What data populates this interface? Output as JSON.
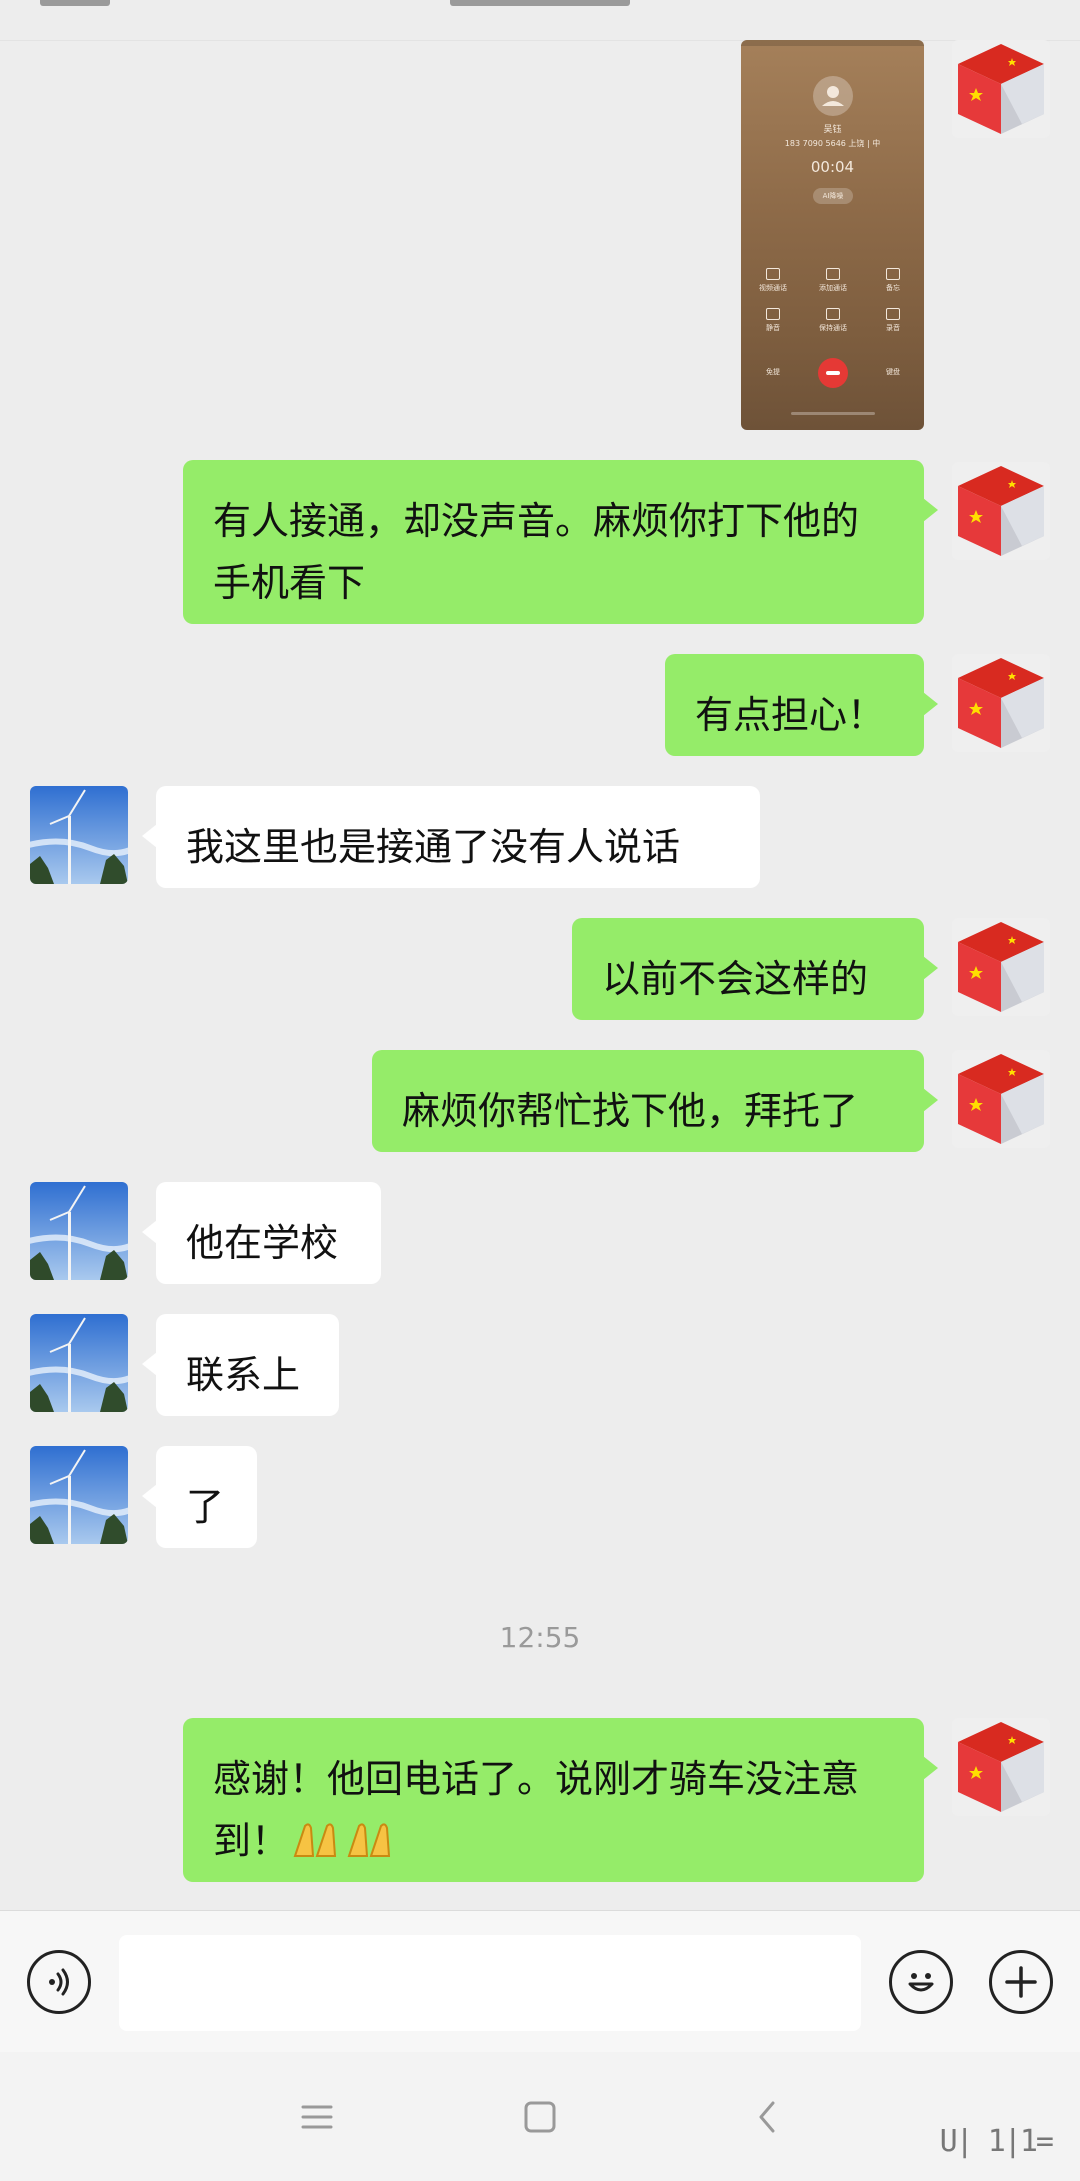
{
  "call_screenshot": {
    "caller_name": "吴钰",
    "caller_info": "183 7090 5646  上饶 | 中",
    "call_timer": "00:04",
    "ai_badge": "AI降噪",
    "controls": [
      "视频通话",
      "添加通话",
      "备忘",
      "静音",
      "保持通话",
      "录音"
    ],
    "speaker_label": "免提",
    "keypad_label": "键盘"
  },
  "messages": [
    {
      "from": "me",
      "text": "有人接通，却没声音。麻烦你打下他的\n手机看下"
    },
    {
      "from": "me",
      "text": "有点担心！"
    },
    {
      "from": "them",
      "text": "我这里也是接通了没有人说话"
    },
    {
      "from": "me",
      "text": "以前不会这样的"
    },
    {
      "from": "me",
      "text": "麻烦你帮忙找下他，拜托了"
    },
    {
      "from": "them",
      "text": "他在学校"
    },
    {
      "from": "them",
      "text": "联系上"
    },
    {
      "from": "them",
      "text": "了"
    },
    {
      "from": "me",
      "text": "感谢！他回电话了。说刚才骑车没注意\n到！"
    }
  ],
  "timestamp": "12:55",
  "composer": {
    "value": "",
    "placeholder": ""
  },
  "watermark": "U| 1|1=",
  "icons": {
    "voice": "voice-input-icon",
    "emoji": "emoji-icon",
    "plus": "plus-icon",
    "nav_menu": "menu-icon",
    "nav_home": "home-icon",
    "nav_back": "back-icon",
    "prayer": "folded-hands-icon"
  }
}
